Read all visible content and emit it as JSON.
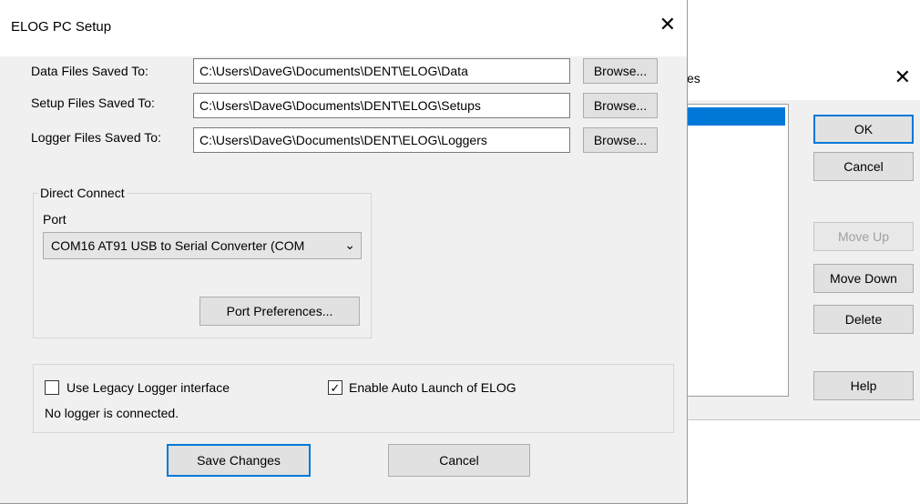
{
  "back_dialog": {
    "title_fragment": "es",
    "close_symbol": "✕",
    "buttons": {
      "ok": "OK",
      "cancel": "Cancel",
      "move_up": "Move Up",
      "move_down": "Move Down",
      "delete": "Delete",
      "help": "Help"
    }
  },
  "dialog": {
    "title": "ELOG PC Setup",
    "close_symbol": "✕",
    "paths": {
      "data_label": "Data Files Saved To:",
      "data_value": "C:\\Users\\DaveG\\Documents\\DENT\\ELOG\\Data",
      "setup_label": "Setup Files Saved To:",
      "setup_value": "C:\\Users\\DaveG\\Documents\\DENT\\ELOG\\Setups",
      "logger_label": "Logger Files Saved To:",
      "logger_value": "C:\\Users\\DaveG\\Documents\\DENT\\ELOG\\Loggers",
      "browse_label": "Browse..."
    },
    "direct_connect": {
      "group_label": "Direct Connect",
      "port_label": "Port",
      "port_value": "COM16 AT91 USB to Serial Converter (COM",
      "port_arrow": "⌄",
      "port_prefs_label": "Port Preferences..."
    },
    "options": {
      "legacy_label": "Use Legacy Logger interface",
      "legacy_checked": false,
      "auto_launch_label": "Enable Auto Launch of ELOG",
      "auto_launch_checked": true,
      "check_mark": "✓",
      "status_text": "No logger is connected."
    },
    "footer": {
      "save_label": "Save Changes",
      "cancel_label": "Cancel"
    }
  }
}
